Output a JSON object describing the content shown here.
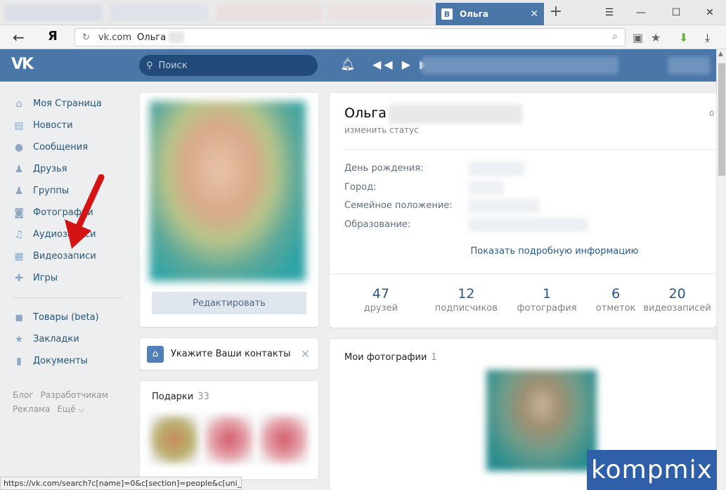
{
  "browser": {
    "active_tab_favicon": "В",
    "active_tab_title": "Ольга",
    "close_glyph": "✕",
    "new_tab_glyph": "+",
    "window_buttons": [
      "☰",
      "—",
      "☐",
      "✕"
    ],
    "back_glyph": "←",
    "yandex_logo": "Я",
    "url_host": "vk.com",
    "url_title": "Ольга"
  },
  "vk_header": {
    "logo": "VK",
    "search_placeholder": "Поиск"
  },
  "menu": {
    "items": [
      {
        "label": "Моя Страница",
        "icon": "home-icon"
      },
      {
        "label": "Новости",
        "icon": "news-icon"
      },
      {
        "label": "Сообщения",
        "icon": "messages-icon"
      },
      {
        "label": "Друзья",
        "icon": "friends-icon"
      },
      {
        "label": "Группы",
        "icon": "groups-icon"
      },
      {
        "label": "Фотографии",
        "icon": "camera-icon"
      },
      {
        "label": "Аудиозаписи",
        "icon": "music-icon"
      },
      {
        "label": "Видеозаписи",
        "icon": "video-icon"
      },
      {
        "label": "Игры",
        "icon": "games-icon"
      }
    ],
    "items2": [
      {
        "label": "Товары (beta)",
        "icon": "goods-icon"
      },
      {
        "label": "Закладки",
        "icon": "star-icon"
      },
      {
        "label": "Документы",
        "icon": "document-icon"
      }
    ],
    "footer": [
      "Блог",
      "Разработчикам",
      "Реклама",
      "Ещё ⌵"
    ]
  },
  "profile": {
    "edit_button": "Редактировать",
    "name": "Ольга",
    "status_link": "изменить статус",
    "info_labels": [
      "День рождения:",
      "Город:",
      "Семейное положение:",
      "Образование:"
    ],
    "more_info": "Показать подробную информацию",
    "counters": [
      {
        "num": "47",
        "label": "друзей"
      },
      {
        "num": "12",
        "label": "подписчиков"
      },
      {
        "num": "1",
        "label": "фотография"
      },
      {
        "num": "6",
        "label": "отметок"
      },
      {
        "num": "20",
        "label": "видеозаписей"
      }
    ]
  },
  "contacts": {
    "text": "Укажите Ваши контакты",
    "close": "✕"
  },
  "gifts": {
    "title": "Подарки",
    "count": "33"
  },
  "photos": {
    "title": "Мои фотографии",
    "count": "1"
  },
  "statusbar": {
    "url": "https://vk.com/search?c[name]=0&c[section]=people&c[uni_..."
  },
  "watermark": {
    "text": "kompmix"
  },
  "colors": {
    "vk_blue": "#4a76a8",
    "link": "#2a5885",
    "arrow_red": "#d41414"
  }
}
